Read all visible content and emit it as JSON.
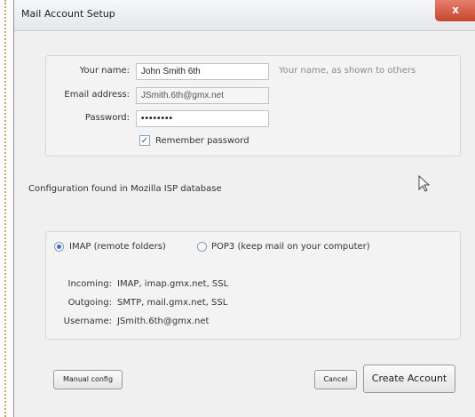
{
  "window": {
    "title": "Mail Account Setup",
    "close_glyph": "x"
  },
  "form": {
    "name_label": "Your name:",
    "name_value": "John Smith 6th",
    "name_hint": "Your name, as shown to others",
    "email_label": "Email address:",
    "email_value": "JSmith.6th@gmx.net",
    "password_label": "Password:",
    "password_value": "••••••••",
    "remember_label": "Remember password",
    "remember_checked": true
  },
  "status": {
    "message": "Configuration found in Mozilla ISP database"
  },
  "protocol": {
    "imap_label": "IMAP (remote folders)",
    "pop3_label": "POP3 (keep mail on your computer)",
    "selected": "IMAP"
  },
  "server": {
    "incoming_label": "Incoming:",
    "incoming_value": "IMAP, imap.gmx.net, SSL",
    "outgoing_label": "Outgoing:",
    "outgoing_value": "SMTP, mail.gmx.net, SSL",
    "username_label": "Username:",
    "username_value": "JSmith.6th@gmx.net"
  },
  "buttons": {
    "manual_config": "Manual config",
    "cancel": "Cancel",
    "create_account": "Create Account"
  },
  "icons": {
    "cursor": "mouse-pointer-icon"
  }
}
